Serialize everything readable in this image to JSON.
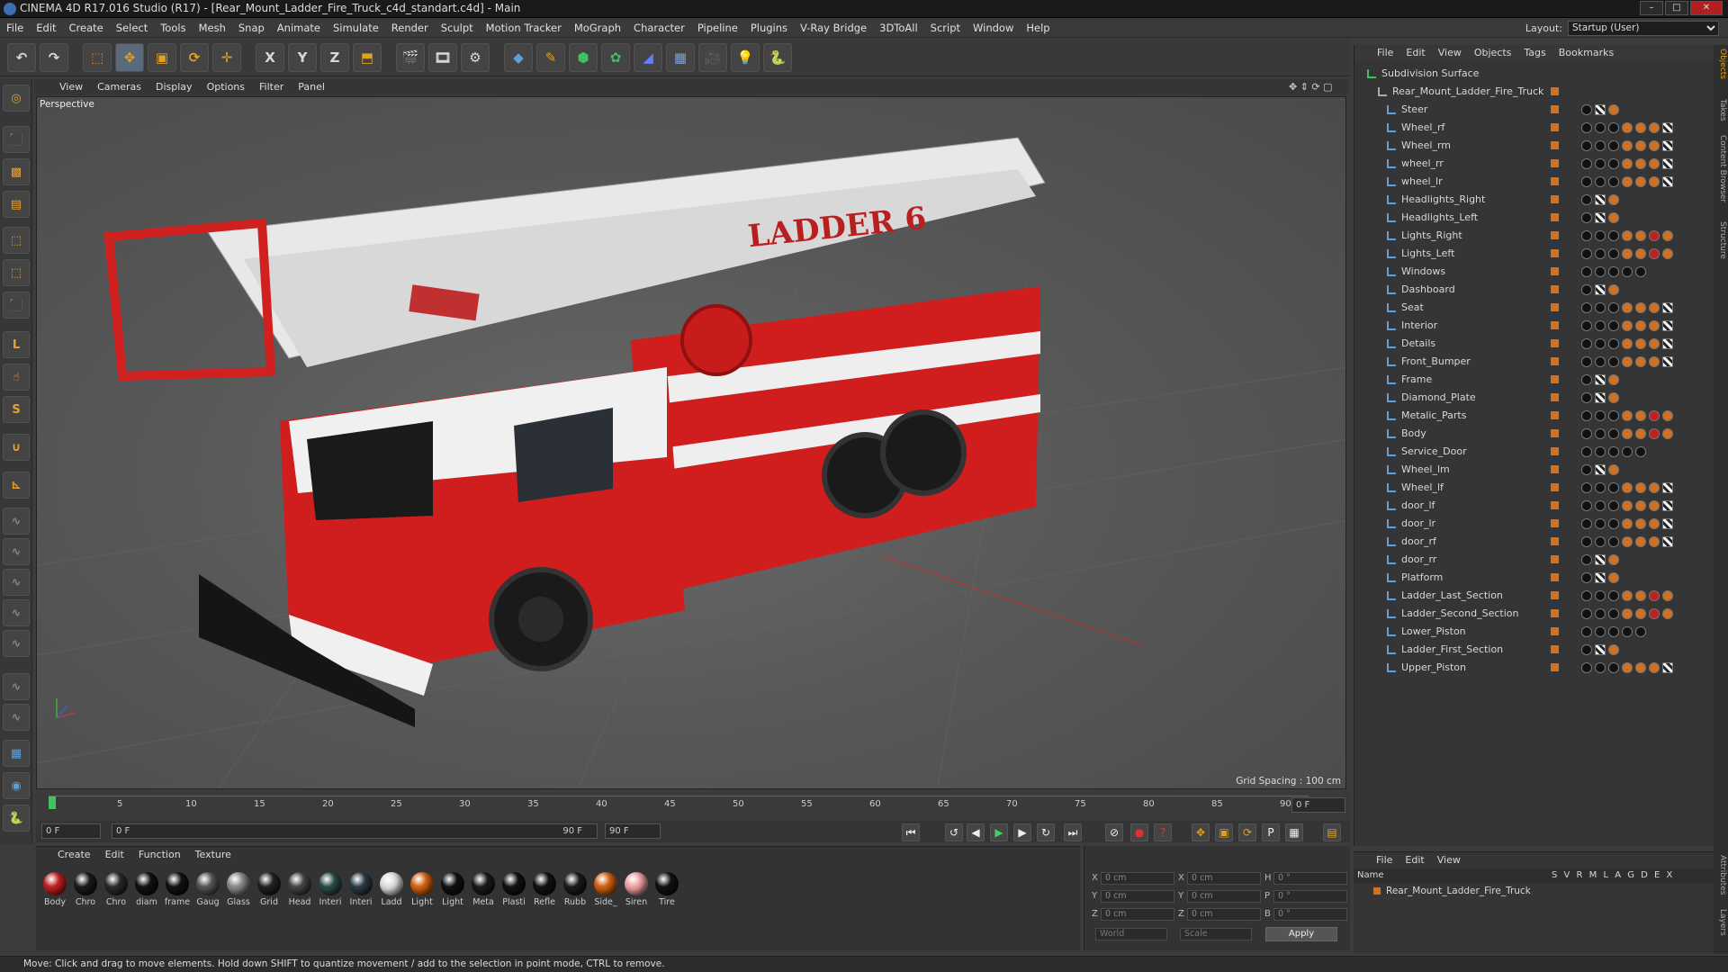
{
  "window": {
    "title": "CINEMA 4D R17.016 Studio (R17) - [Rear_Mount_Ladder_Fire_Truck_c4d_standart.c4d] - Main"
  },
  "menubar": [
    "File",
    "Edit",
    "Create",
    "Select",
    "Tools",
    "Mesh",
    "Snap",
    "Animate",
    "Simulate",
    "Render",
    "Sculpt",
    "Motion Tracker",
    "MoGraph",
    "Character",
    "Pipeline",
    "Plugins",
    "V-Ray Bridge",
    "3DToAll",
    "Script",
    "Window",
    "Help"
  ],
  "layout": {
    "label": "Layout:",
    "value": "Startup (User)"
  },
  "viewport": {
    "menu": [
      "View",
      "Cameras",
      "Display",
      "Options",
      "Filter",
      "Panel"
    ],
    "label": "Perspective",
    "grid_spacing": "Grid Spacing : 100 cm",
    "truck_text": "LADDER 6"
  },
  "timeline": {
    "ticks": [
      "0",
      "5",
      "10",
      "15",
      "20",
      "25",
      "30",
      "35",
      "40",
      "45",
      "50",
      "55",
      "60",
      "65",
      "70",
      "75",
      "80",
      "85",
      "90"
    ],
    "current": "0 F",
    "start": "0 F",
    "range_start": "0 F",
    "range_end": "90 F",
    "end": "90 F"
  },
  "materials": {
    "menu": [
      "Create",
      "Edit",
      "Function",
      "Texture"
    ],
    "items": [
      {
        "label": "Body",
        "color": "#c02020"
      },
      {
        "label": "Chro",
        "color": "#1a1a1a"
      },
      {
        "label": "Chro",
        "color": "#2a2a2a"
      },
      {
        "label": "diam",
        "color": "#111"
      },
      {
        "label": "frame",
        "color": "#111"
      },
      {
        "label": "Gaug",
        "color": "#555"
      },
      {
        "label": "Glass",
        "color": "#888"
      },
      {
        "label": "Grid",
        "color": "#222"
      },
      {
        "label": "Head",
        "color": "#444"
      },
      {
        "label": "Interi",
        "color": "#2a4a44"
      },
      {
        "label": "Interi",
        "color": "#2a3a44"
      },
      {
        "label": "Ladd",
        "color": "#ddd"
      },
      {
        "label": "Light",
        "color": "#d06010"
      },
      {
        "label": "Light",
        "color": "#111"
      },
      {
        "label": "Meta",
        "color": "#1a1a1a"
      },
      {
        "label": "Plasti",
        "color": "#111"
      },
      {
        "label": "Refle",
        "color": "#111"
      },
      {
        "label": "Rubb",
        "color": "#1a1a1a"
      },
      {
        "label": "Side_",
        "color": "#d06010"
      },
      {
        "label": "Siren",
        "color": "#f0a0a0"
      },
      {
        "label": "Tire",
        "color": "#111"
      }
    ]
  },
  "coords": {
    "x": "0 cm",
    "y": "0 cm",
    "z": "0 cm",
    "x2": "0 cm",
    "y2": "0 cm",
    "z2": "0 cm",
    "h": "0 °",
    "p": "0 °",
    "b": "0 °",
    "world": "World",
    "scale": "Scale",
    "apply": "Apply"
  },
  "objects": {
    "menu": [
      "File",
      "Edit",
      "View",
      "Objects",
      "Tags",
      "Bookmarks"
    ],
    "root": "Subdivision Surface",
    "group": "Rear_Mount_Ladder_Fire_Truck",
    "items": [
      "Steer",
      "Wheel_rf",
      "Wheel_rm",
      "wheel_rr",
      "wheel_lr",
      "Headlights_Right",
      "Headlights_Left",
      "Lights_Right",
      "Lights_Left",
      "Windows",
      "Dashboard",
      "Seat",
      "Interior",
      "Details",
      "Front_Bumper",
      "Frame",
      "Diamond_Plate",
      "Metalic_Parts",
      "Body",
      "Service_Door",
      "Wheel_lm",
      "Wheel_lf",
      "door_lf",
      "door_lr",
      "door_rf",
      "door_rr",
      "Platform",
      "Ladder_Last_Section",
      "Ladder_Second_Section",
      "Lower_Piston",
      "Ladder_First_Section",
      "Upper_Piston"
    ]
  },
  "attributes": {
    "menu": [
      "File",
      "Edit",
      "View"
    ],
    "name_header": "Name",
    "cols": "S V R M L A G D E X",
    "row": "Rear_Mount_Ladder_Fire_Truck"
  },
  "right_tabs": [
    "Objects",
    "Takes",
    "Content Browser",
    "Structure",
    "Attributes",
    "Layers"
  ],
  "status": "Move: Click and drag to move elements. Hold down SHIFT to quantize movement / add to the selection in point mode, CTRL to remove."
}
